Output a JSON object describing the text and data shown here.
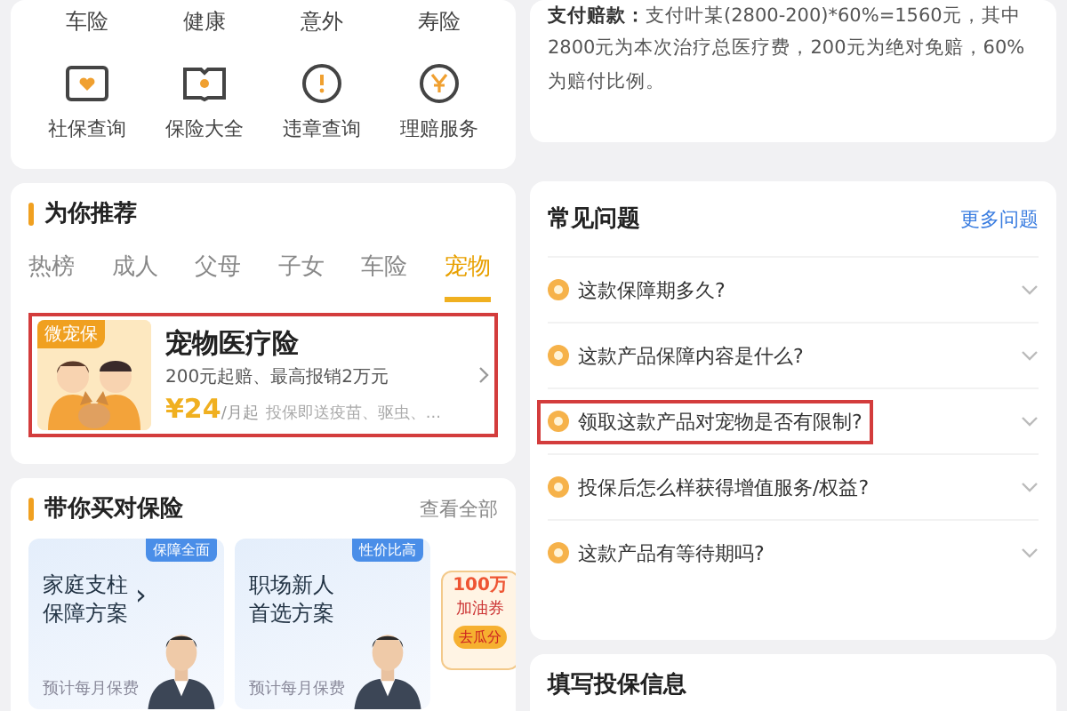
{
  "top_card": {
    "categories": [
      "车险",
      "健康",
      "意外",
      "寿险"
    ],
    "services": [
      {
        "kind": "heart",
        "label": "社保查询"
      },
      {
        "kind": "book",
        "label": "保险大全"
      },
      {
        "kind": "alert",
        "label": "违章查询"
      },
      {
        "kind": "yen",
        "label": "理赔服务"
      }
    ]
  },
  "recommend": {
    "title": "为你推荐",
    "tabs": [
      {
        "label": "热榜",
        "selected": false
      },
      {
        "label": "成人",
        "selected": false
      },
      {
        "label": "父母",
        "selected": false
      },
      {
        "label": "子女",
        "selected": false
      },
      {
        "label": "车险",
        "selected": false
      },
      {
        "label": "宠物",
        "selected": true
      }
    ],
    "product": {
      "badge": "微宠保",
      "name": "宠物医疗险",
      "summary": "200元起赔、最高报销2万元",
      "price": "¥24",
      "unit": "/月起",
      "perks": "投保即送疫苗、驱虫、...",
      "highlighted": true
    }
  },
  "plans": {
    "title": "带你买对保险",
    "more": "查看全部",
    "cards": [
      {
        "tag": "保障全面",
        "title": [
          "家庭支柱",
          "保障方案"
        ],
        "fee": "预计每月保费",
        "chevron": "›"
      },
      {
        "tag": "性价比高",
        "title": [
          "职场新人",
          "首选方案"
        ],
        "fee": "预计每月保费"
      }
    ],
    "promo": {
      "amount": "100万",
      "name": "加油券",
      "action": "去瓜分"
    }
  },
  "claim_note": {
    "text": "**支付赔款：**支付叶某(2800-200)*60%=1560元，其中2800元为本次治疗总医疗费，200元为绝对免赔，60%为赔付比例。"
  },
  "faq": {
    "title": "常见问题",
    "more": "更多问题",
    "items": [
      {
        "question": "这款保障期多久?",
        "highlighted": false
      },
      {
        "question": "这款产品保障内容是什么?",
        "highlighted": false
      },
      {
        "question": "领取这款产品对宠物是否有限制?",
        "highlighted": true
      },
      {
        "question": "投保后怎么样获得增值服务/权益?",
        "highlighted": false
      },
      {
        "question": "这款产品有等待期吗?",
        "highlighted": false
      }
    ]
  },
  "form": {
    "title": "填写投保信息"
  }
}
